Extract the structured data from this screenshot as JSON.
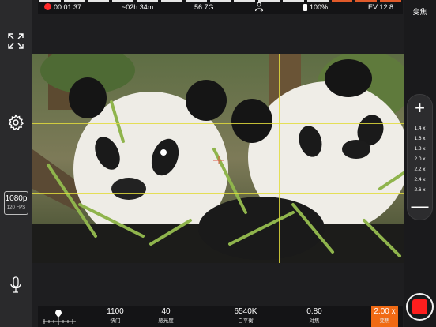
{
  "status_bar": {
    "record_time": "00:01:37",
    "remaining_time": "~02h 34m",
    "storage": "56.7G",
    "battery": "100%",
    "ev": "EV 12.8",
    "person_icon": "person-detect-icon",
    "battery_icon": "battery-icon"
  },
  "left_rail": {
    "fullscreen_icon": "expand-icon",
    "settings_icon": "gear-icon",
    "resolution": "1080p",
    "fps": "120 FPS",
    "mic_icon": "microphone-icon"
  },
  "right_rail": {
    "zoom_title": "变焦",
    "zoom_plus": "+",
    "zoom_minus": "—",
    "zoom_levels": [
      "1.4 x",
      "1.6 x",
      "1.8 x",
      "2.0 x",
      "2.2 x",
      "2.4 x",
      "2.6 x"
    ],
    "record_icon": "record-stop-icon"
  },
  "bottom_bar": {
    "focus_slider_icon": "focus-slider-icon",
    "shutter": {
      "value": "1100",
      "label": "快门"
    },
    "iso": {
      "value": "40",
      "label": "感光度"
    },
    "white_balance": {
      "value": "6540K",
      "label": "白平衡"
    },
    "focus": {
      "value": "0.80",
      "label": "对焦"
    },
    "zoom": {
      "value": "2.00 x",
      "label": "变焦"
    }
  },
  "colors": {
    "record_red": "#ff1e1e",
    "accent_orange": "#f06a14",
    "grid_yellow": "#e2dc3c"
  }
}
